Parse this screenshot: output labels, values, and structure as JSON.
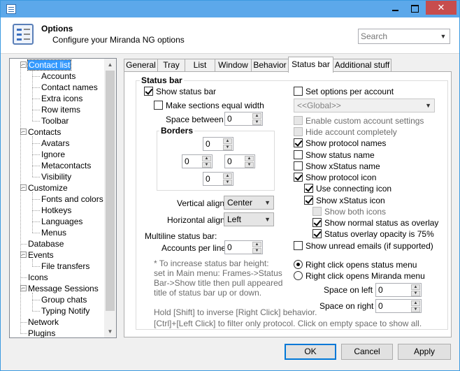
{
  "window": {
    "colors": {
      "titlebar": "#5ca8ea",
      "close": "#c74d4d",
      "selection": "#3399ff"
    }
  },
  "header": {
    "title": "Options",
    "subtitle": "Configure your Miranda NG options",
    "search_placeholder": "Search"
  },
  "tree": {
    "items": [
      {
        "label": "Contact list",
        "level": 0,
        "expanded": true,
        "selected": true
      },
      {
        "label": "Accounts",
        "level": 1
      },
      {
        "label": "Contact names",
        "level": 1
      },
      {
        "label": "Extra icons",
        "level": 1
      },
      {
        "label": "Row items",
        "level": 1
      },
      {
        "label": "Toolbar",
        "level": 1
      },
      {
        "label": "Contacts",
        "level": 0,
        "expanded": true
      },
      {
        "label": "Avatars",
        "level": 1
      },
      {
        "label": "Ignore",
        "level": 1
      },
      {
        "label": "Metacontacts",
        "level": 1
      },
      {
        "label": "Visibility",
        "level": 1
      },
      {
        "label": "Customize",
        "level": 0,
        "expanded": true
      },
      {
        "label": "Fonts and colors",
        "level": 1
      },
      {
        "label": "Hotkeys",
        "level": 1
      },
      {
        "label": "Languages",
        "level": 1
      },
      {
        "label": "Menus",
        "level": 1
      },
      {
        "label": "Database",
        "level": 0
      },
      {
        "label": "Events",
        "level": 0,
        "expanded": true
      },
      {
        "label": "File transfers",
        "level": 1
      },
      {
        "label": "Icons",
        "level": 0
      },
      {
        "label": "Message Sessions",
        "level": 0,
        "expanded": true
      },
      {
        "label": "Group chats",
        "level": 1
      },
      {
        "label": "Typing Notify",
        "level": 1
      },
      {
        "label": "Network",
        "level": 0
      },
      {
        "label": "Plugins",
        "level": 0
      }
    ]
  },
  "tabs": [
    {
      "label": "General"
    },
    {
      "label": "Tray"
    },
    {
      "label": "List"
    },
    {
      "label": "Window"
    },
    {
      "label": "Behavior"
    },
    {
      "label": "Status bar",
      "active": true
    },
    {
      "label": "Additional stuff"
    }
  ],
  "statusbar": {
    "section_title": "Status bar",
    "show_status_bar": "Show status bar",
    "make_sections_equal": "Make sections equal width",
    "space_between_label": "Space between",
    "space_between_value": "0",
    "borders_title": "Borders",
    "border_top": "0",
    "border_left": "0",
    "border_right": "0",
    "border_bottom": "0",
    "vertical_align_label": "Vertical align",
    "vertical_align_value": "Center",
    "horizontal_align_label": "Horizontal align",
    "horizontal_align_value": "Left",
    "multiline_label": "Multiline status bar:",
    "accounts_per_line_label": "Accounts per line",
    "accounts_per_line_value": "0",
    "hint_lines": [
      "* To increase status bar height:",
      "set in Main menu: Frames->Status",
      "Bar->Show title then pull appeared",
      "title of status bar up or down."
    ],
    "bottom_hint_1": "Hold [Shift] to inverse [Right Click] behavior.",
    "bottom_hint_2": "[Ctrl]+[Left Click] to filter only protocol. Click on empty space to show all."
  },
  "right": {
    "set_per_account": "Set options per account",
    "account_combo": "<<Global>>",
    "enable_custom": "Enable custom account settings",
    "hide_completely": "Hide account completely",
    "show_protocol_names": "Show protocol names",
    "show_status_name": "Show status name",
    "show_xstatus_name": "Show xStatus name",
    "show_protocol_icon": "Show protocol icon",
    "use_connecting_icon": "Use connecting icon",
    "show_xstatus_icon": "Show xStatus icon",
    "show_both_icons": "Show both icons",
    "show_normal_overlay": "Show normal status as overlay",
    "status_overlay_opacity": "Status overlay opacity is 75%",
    "show_unread_emails": "Show unread emails (if supported)",
    "right_click_status": "Right click opens status menu",
    "right_click_miranda": "Right click opens Miranda menu",
    "space_left_label": "Space on left",
    "space_left_value": "0",
    "space_right_label": "Space on right",
    "space_right_value": "0"
  },
  "footer": {
    "ok": "OK",
    "cancel": "Cancel",
    "apply": "Apply"
  }
}
